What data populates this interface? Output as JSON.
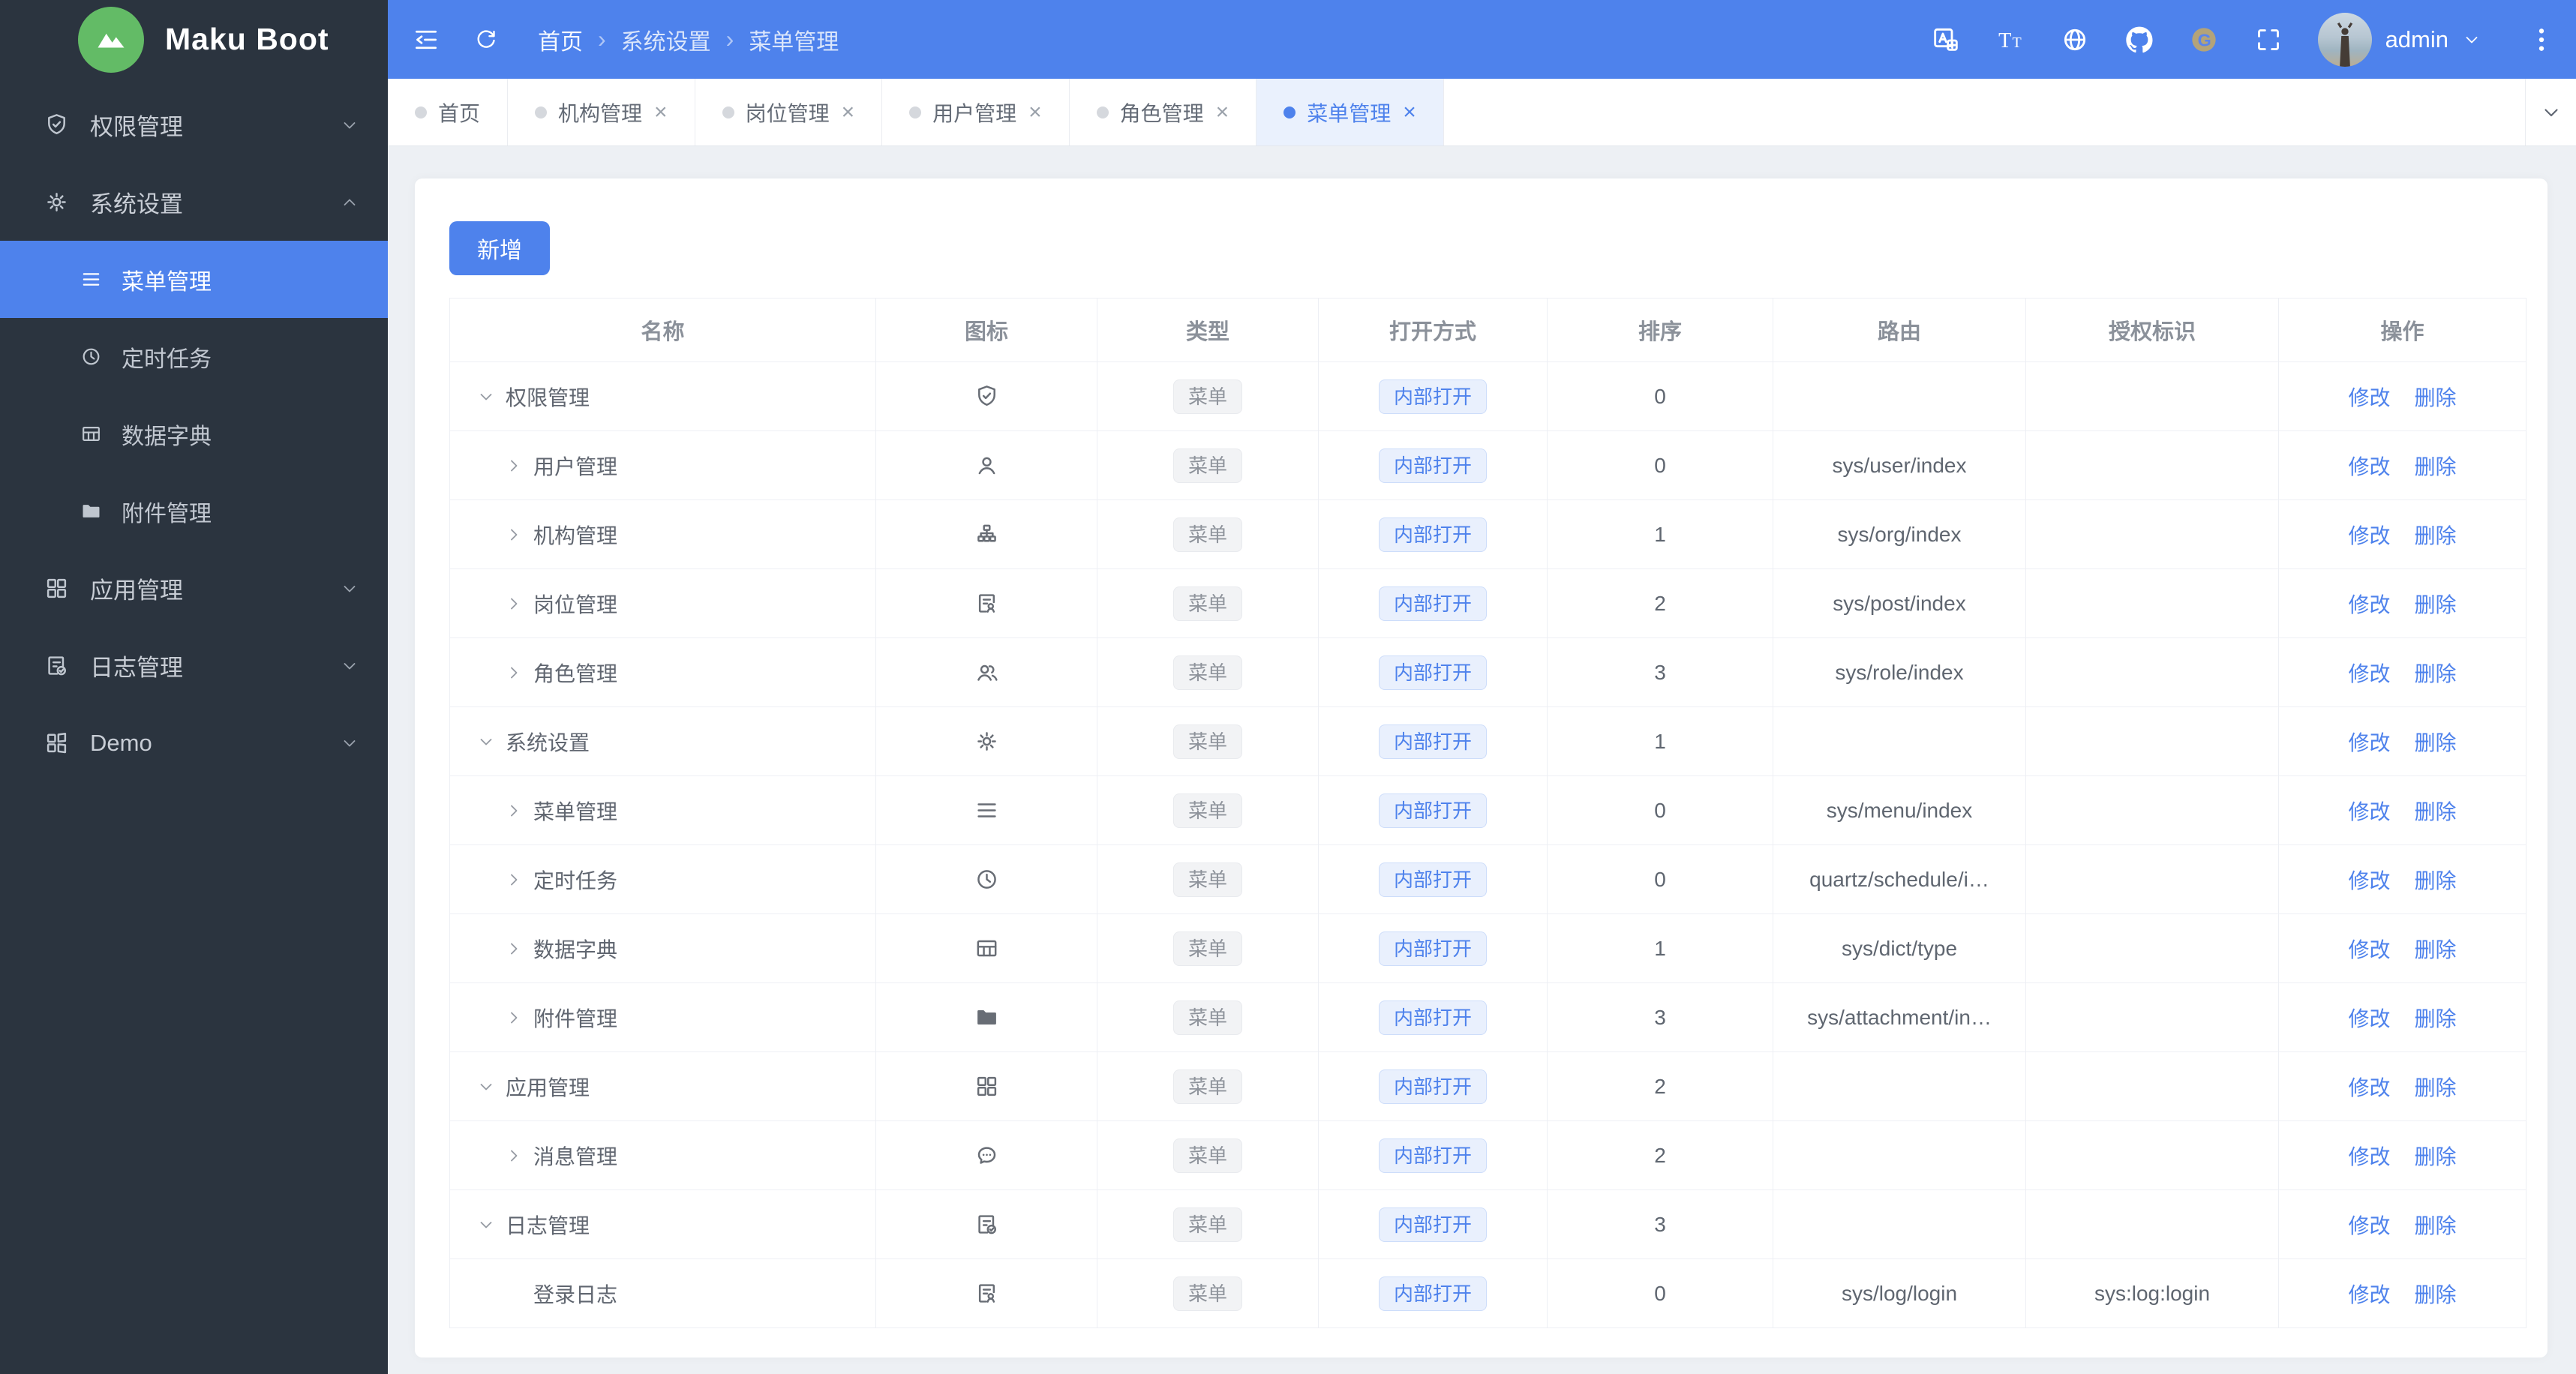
{
  "colors": {
    "primary": "#4e82ec",
    "primary_light": "#e9f0fd",
    "sidebar_bg": "#2b343f",
    "content_bg": "#edf0f4",
    "logo_green": "#63bb66",
    "gitee_gold": "#b3a379"
  },
  "glyphs": {
    "close": "×",
    "crumb_sep": "›"
  },
  "sidebar": {
    "logo_text": "Maku Boot",
    "items": [
      {
        "label": "权限管理",
        "icon": "shield",
        "kind": "group",
        "chevron": "down"
      },
      {
        "label": "系统设置",
        "icon": "gear",
        "kind": "group",
        "chevron": "up"
      },
      {
        "label": "菜单管理",
        "icon": "menu",
        "kind": "child",
        "active": true
      },
      {
        "label": "定时任务",
        "icon": "clock",
        "kind": "child"
      },
      {
        "label": "数据字典",
        "icon": "table",
        "kind": "child"
      },
      {
        "label": "附件管理",
        "icon": "folder",
        "kind": "child"
      },
      {
        "label": "应用管理",
        "icon": "grid",
        "kind": "group",
        "chevron": "down"
      },
      {
        "label": "日志管理",
        "icon": "doccheck",
        "kind": "group",
        "chevron": "down"
      },
      {
        "label": "Demo",
        "icon": "grid2",
        "kind": "group",
        "chevron": "down"
      }
    ]
  },
  "header": {
    "breadcrumb": [
      "首页",
      "系统设置",
      "菜单管理"
    ],
    "user": "admin"
  },
  "tabs": [
    {
      "label": "首页",
      "closable": false,
      "active": false
    },
    {
      "label": "机构管理",
      "closable": true,
      "active": false
    },
    {
      "label": "岗位管理",
      "closable": true,
      "active": false
    },
    {
      "label": "用户管理",
      "closable": true,
      "active": false
    },
    {
      "label": "角色管理",
      "closable": true,
      "active": false
    },
    {
      "label": "菜单管理",
      "closable": true,
      "active": true
    }
  ],
  "toolbar": {
    "add_label": "新增"
  },
  "table": {
    "columns": [
      "名称",
      "图标",
      "类型",
      "打开方式",
      "排序",
      "路由",
      "授权标识",
      "操作"
    ],
    "type_tag": "菜单",
    "open_tag": "内部打开",
    "actions": [
      "修改",
      "删除"
    ],
    "rows": [
      {
        "name": "权限管理",
        "level": 0,
        "expand": "down",
        "icon": "shield",
        "sort": "0",
        "route": "",
        "auth": ""
      },
      {
        "name": "用户管理",
        "level": 1,
        "expand": "right",
        "icon": "user",
        "sort": "0",
        "route": "sys/user/index",
        "auth": ""
      },
      {
        "name": "机构管理",
        "level": 1,
        "expand": "right",
        "icon": "org",
        "sort": "1",
        "route": "sys/org/index",
        "auth": ""
      },
      {
        "name": "岗位管理",
        "level": 1,
        "expand": "right",
        "icon": "docuser",
        "sort": "2",
        "route": "sys/post/index",
        "auth": ""
      },
      {
        "name": "角色管理",
        "level": 1,
        "expand": "right",
        "icon": "users",
        "sort": "3",
        "route": "sys/role/index",
        "auth": ""
      },
      {
        "name": "系统设置",
        "level": 0,
        "expand": "down",
        "icon": "gear",
        "sort": "1",
        "route": "",
        "auth": ""
      },
      {
        "name": "菜单管理",
        "level": 1,
        "expand": "right",
        "icon": "menu",
        "sort": "0",
        "route": "sys/menu/index",
        "auth": ""
      },
      {
        "name": "定时任务",
        "level": 1,
        "expand": "right",
        "icon": "clock",
        "sort": "0",
        "route": "quartz/schedule/i…",
        "auth": ""
      },
      {
        "name": "数据字典",
        "level": 1,
        "expand": "right",
        "icon": "table",
        "sort": "1",
        "route": "sys/dict/type",
        "auth": ""
      },
      {
        "name": "附件管理",
        "level": 1,
        "expand": "right",
        "icon": "folder",
        "sort": "3",
        "route": "sys/attachment/in…",
        "auth": ""
      },
      {
        "name": "应用管理",
        "level": 0,
        "expand": "down",
        "icon": "grid",
        "sort": "2",
        "route": "",
        "auth": ""
      },
      {
        "name": "消息管理",
        "level": 1,
        "expand": "right",
        "icon": "chat",
        "sort": "2",
        "route": "",
        "auth": ""
      },
      {
        "name": "日志管理",
        "level": 0,
        "expand": "down",
        "icon": "doccheck",
        "sort": "3",
        "route": "",
        "auth": ""
      },
      {
        "name": "登录日志",
        "level": 1,
        "expand": "none",
        "icon": "docuser",
        "sort": "0",
        "route": "sys/log/login",
        "auth": "sys:log:login"
      }
    ]
  }
}
